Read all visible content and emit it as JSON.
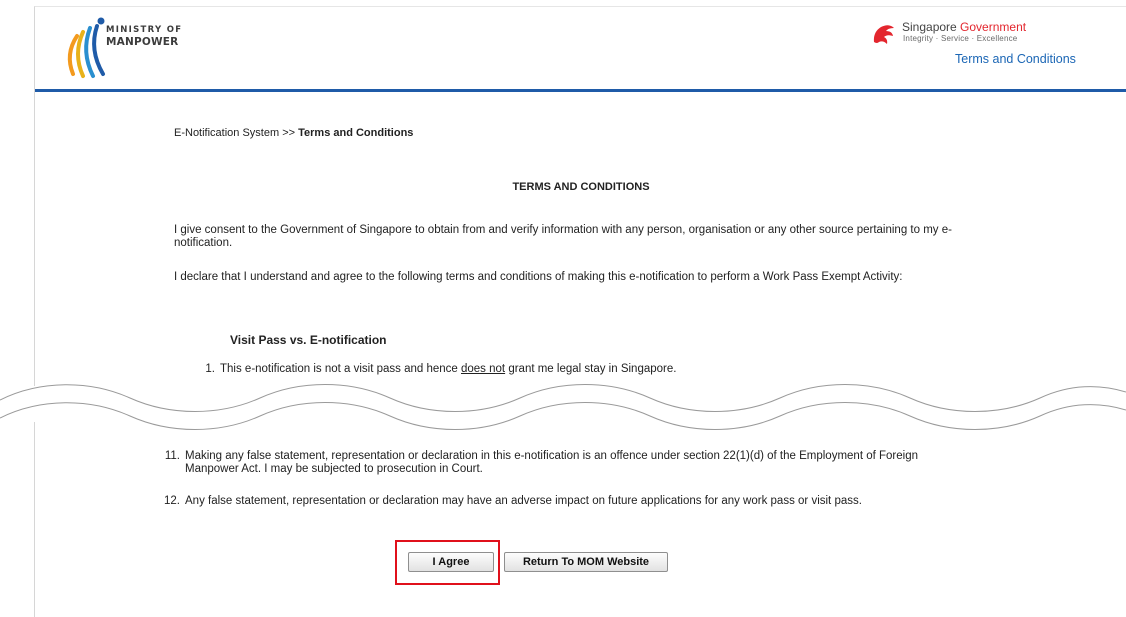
{
  "header": {
    "mom_logo": {
      "line1": "MINISTRY OF",
      "line2": "MANPOWER"
    },
    "sg_logo": {
      "title_part1": "Singapore ",
      "title_part2": "Government",
      "tagline": "Integrity · Service · Excellence"
    },
    "terms_link": "Terms and Conditions"
  },
  "breadcrumb": {
    "root": "E-Notification System >> ",
    "current": "Terms and Conditions"
  },
  "heading": "TERMS AND CONDITIONS",
  "paragraphs": [
    "I give consent to the Government of Singapore to obtain from and verify information with any person, organisation or any other source pertaining to my e-notification.",
    "I declare that I understand and agree to the following terms and conditions of making this e-notification to perform a Work Pass Exempt Activity:"
  ],
  "section_title": "Visit Pass vs. E-notification",
  "items": [
    {
      "num": "1.",
      "before": "This e-notification is not a visit pass and hence ",
      "underlined": "does not",
      "after": " grant me legal stay in Singapore."
    },
    {
      "num": "11.",
      "text": "Making any false statement, representation or declaration in this e-notification is an offence under section 22(1)(d) of the Employment of Foreign Manpower Act. I may be subjected to prosecution in Court."
    },
    {
      "num": "12.",
      "text": "Any false statement, representation or declaration may have an adverse impact on future applications for any work pass or visit pass."
    }
  ],
  "buttons": {
    "agree": "I Agree",
    "return": "Return To MOM Website"
  },
  "colors": {
    "brand_blue": "#1f5ba8",
    "link_blue": "#1b66b5",
    "highlight_red": "#e0101b",
    "sg_red": "#e3262e"
  }
}
